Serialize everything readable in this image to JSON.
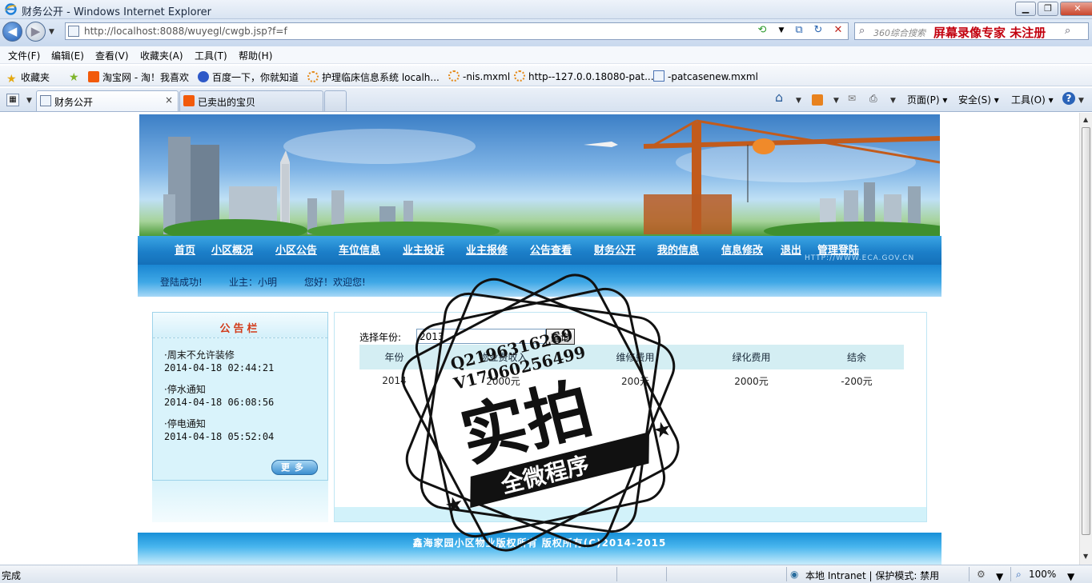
{
  "window": {
    "title": "财务公开 - Windows Internet Explorer",
    "minimize": "▁",
    "restore": "❐",
    "close": "✕"
  },
  "address": {
    "url": "http://localhost:8088/wuyegl/cwgb.jsp?f=f",
    "search_placeholder": "360综合搜索",
    "recorder_banner": "屏幕录像专家 未注册"
  },
  "menu": [
    "文件(F)",
    "编辑(E)",
    "查看(V)",
    "收藏夹(A)",
    "工具(T)",
    "帮助(H)"
  ],
  "favorites": {
    "label": "收藏夹",
    "items": [
      "淘宝网 - 淘！我喜欢",
      "百度一下，你就知道",
      "护理临床信息系统 localh...",
      "-nis.mxml",
      "http--127.0.0.18080-pat...",
      "-patcasenew.mxml"
    ]
  },
  "tabs": [
    {
      "label": "财务公开",
      "close": "×"
    },
    {
      "label": "已卖出的宝贝"
    }
  ],
  "commands": {
    "page": "页面(P)",
    "safety": "安全(S)",
    "tools": "工具(O)",
    "help": "?"
  },
  "site": {
    "nav": [
      "首页",
      "小区概况",
      "小区公告",
      "车位信息",
      "业主投诉",
      "业主报修",
      "公告查看",
      "财务公开",
      "我的信息",
      "信息修改",
      "退出",
      "管理登陆"
    ],
    "site_url": "HTTP://WWW.ECA.GOV.CN",
    "welcome": {
      "login_ok": "登陆成功!",
      "owner": "业主：小明",
      "greeting": "您好！欢迎您!"
    },
    "notice_board": {
      "title": "公告栏",
      "items": [
        {
          "title": "·周末不允许装修",
          "date": "2014-04-18 02:44:21"
        },
        {
          "title": "·停水通知",
          "date": "2014-04-18 06:08:56"
        },
        {
          "title": "·停电通知",
          "date": "2014-04-18 05:52:04"
        }
      ],
      "more": "更多"
    },
    "finance": {
      "year_label": "选择年份:",
      "year_value": "2013",
      "query": "查询",
      "columns": [
        "年份",
        "物业费收入",
        "维修费用",
        "绿化费用",
        "结余"
      ],
      "rows": [
        [
          "2014",
          "2000元",
          "200元",
          "2000元",
          "-200元"
        ]
      ]
    },
    "footer": "鑫海家园小区物业版权所有 版权所有(C)2014-2015"
  },
  "watermark": {
    "line1": "Q2196316269",
    "line2": "V17060256499",
    "big": "实拍",
    "ribbon": "全微程序"
  },
  "status": {
    "left": "完成",
    "zone": "本地 Intranet | 保护模式: 禁用",
    "zoom": "100%"
  }
}
